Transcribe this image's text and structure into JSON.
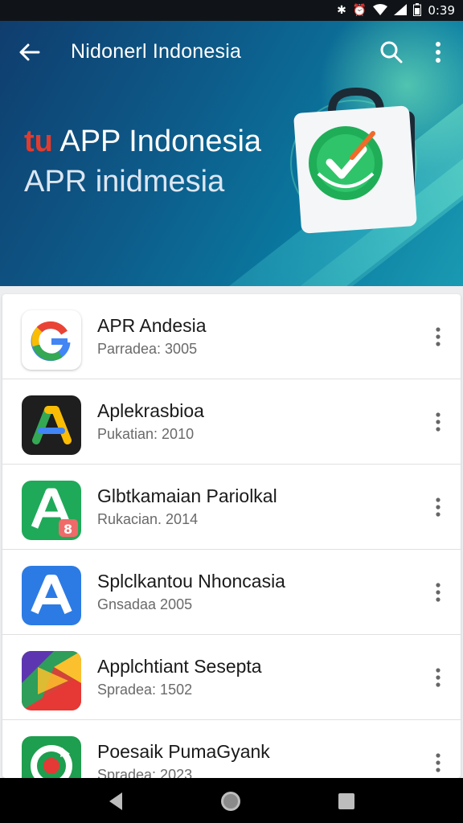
{
  "status_bar": {
    "time": "0:39",
    "icons": [
      "bluetooth-icon",
      "alarm-icon",
      "wifi-icon",
      "signal-icon",
      "battery-icon"
    ]
  },
  "appbar": {
    "title": "Nidonerl Indonesia",
    "back_icon": "arrow-left-icon",
    "search_icon": "search-icon",
    "more_icon": "more-vertical-icon"
  },
  "hero": {
    "brand_prefix": "tu",
    "headline": "APP Indonesia",
    "subheadline": "APR inidmesia",
    "art_icon": "shopping-bag-checkmark-icon"
  },
  "apps": [
    {
      "name": "APR Andesia",
      "subtitle": "Parradea: 3005",
      "icon": "google-g-icon"
    },
    {
      "name": "Aplekrasbioa",
      "subtitle": "Pukatian: 2010",
      "icon": "triangle-a-dark-icon"
    },
    {
      "name": "Glbtkamaian Pariolkal",
      "subtitle": "Rukacian. 2014",
      "icon": "a-green-badge-icon"
    },
    {
      "name": "Splclkantou Nhoncasia",
      "subtitle": "Gnsadaa 2005",
      "icon": "a-blue-icon"
    },
    {
      "name": "Applchtiant Sesepta",
      "subtitle": "Spradea: 1502",
      "icon": "colorful-play-icon"
    },
    {
      "name": "Poesaik PumaGyank",
      "subtitle": "Spradea: 2023",
      "icon": "green-refresh-icon"
    }
  ],
  "nav_bar": {
    "back_icon": "nav-back-icon",
    "home_icon": "nav-home-icon",
    "recents_icon": "nav-recents-icon"
  },
  "colors": {
    "hero_start": "#0f3d6e",
    "hero_end": "#1a9ab2",
    "brand_red": "#e23b2e",
    "status_bar": "#101418",
    "nav_bar": "#000000"
  }
}
